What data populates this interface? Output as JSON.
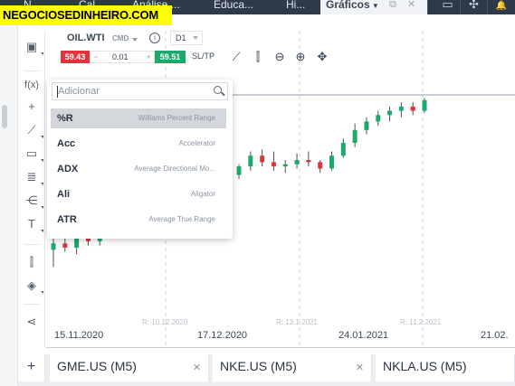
{
  "brand": "NEGOCIOSEDINHEIRO.COM",
  "top_tabs": [
    {
      "label": "N"
    },
    {
      "label": "Cal"
    },
    {
      "label": "Análise ..."
    },
    {
      "label": "Educa..."
    },
    {
      "label": "Hi..."
    },
    {
      "label": "Gráficos",
      "active": true
    }
  ],
  "top_icons": {
    "popout": "external-link-icon",
    "close": "close-icon"
  },
  "top_right": [
    {
      "name": "layout-icon",
      "glyph": "▭"
    },
    {
      "name": "settings-icon",
      "glyph": "✣"
    },
    {
      "name": "bell-icon",
      "glyph": "🔔"
    }
  ],
  "chart_header": {
    "symbol": "OIL.WTI",
    "type_label": "CMD",
    "info_glyph": "i",
    "timeframe": "D1",
    "sell_price": "59.43",
    "quantity": "0.01",
    "minus": "−",
    "plus": "+",
    "buy_price": "59.51",
    "sltp_label": "SL/TP"
  },
  "indicator_search": {
    "placeholder": "Adicionar",
    "items": [
      {
        "abbr": "%R",
        "name": "Williams Percent Range"
      },
      {
        "abbr": "Acc",
        "name": "Accelerator"
      },
      {
        "abbr": "ADX",
        "name": "Average Directional Mo..."
      },
      {
        "abbr": "Ali",
        "name": "Aligator"
      },
      {
        "abbr": "ATR",
        "name": "Average True Range"
      }
    ]
  },
  "rollover_labels": [
    "R: 10.12.2020",
    "R: 13.1.2021",
    "R: 11.2.2021"
  ],
  "x_axis_labels": [
    "15.11.2020",
    "17.12.2020",
    "24.01.2021",
    "21.02."
  ],
  "bottom_tabs": [
    {
      "label": "GME.US (M5)"
    },
    {
      "label": "NKE.US (M5)"
    },
    {
      "label": "NKLA.US (M5)"
    }
  ],
  "colors": {
    "up": "#1ea86c",
    "down": "#e0343d",
    "brand_bg": "#ffff00",
    "topbar": "#2e3a4a"
  },
  "chart_data": {
    "type": "candlestick",
    "series": [
      {
        "o": 1,
        "h": 1.6,
        "l": 0.2,
        "c": 1.3
      },
      {
        "o": 1.3,
        "h": 1.7,
        "l": 0.9,
        "c": 1.1
      },
      {
        "o": 1.1,
        "h": 1.8,
        "l": 0.8,
        "c": 1.6
      },
      {
        "o": 1.6,
        "h": 1.9,
        "l": 1.2,
        "c": 1.4
      },
      {
        "o": 1.4,
        "h": 2.3,
        "l": 1.2,
        "c": 2.1
      },
      {
        "o": 2.1,
        "h": 2.9,
        "l": 1.9,
        "c": 2.6
      },
      {
        "o": 2.6,
        "h": 3.0,
        "l": 2.2,
        "c": 2.4
      },
      {
        "o": 2.4,
        "h": 3.5,
        "l": 2.3,
        "c": 3.3
      },
      {
        "o": 3.3,
        "h": 3.6,
        "l": 2.9,
        "c": 3.2
      },
      {
        "o": 3.2,
        "h": 3.8,
        "l": 3.0,
        "c": 3.6
      },
      {
        "o": 3.6,
        "h": 4.1,
        "l": 3.2,
        "c": 3.9
      },
      {
        "o": 3.9,
        "h": 4.3,
        "l": 3.6,
        "c": 3.7
      },
      {
        "o": 3.7,
        "h": 4.6,
        "l": 3.5,
        "c": 4.4
      },
      {
        "o": 4.4,
        "h": 4.9,
        "l": 4.1,
        "c": 4.6
      },
      {
        "o": 4.6,
        "h": 5.1,
        "l": 4.2,
        "c": 4.8
      },
      {
        "o": 4.8,
        "h": 5.2,
        "l": 4.4,
        "c": 4.5
      },
      {
        "o": 4.5,
        "h": 5.0,
        "l": 4.3,
        "c": 4.9
      },
      {
        "o": 4.9,
        "h": 5.6,
        "l": 4.7,
        "c": 5.4
      },
      {
        "o": 5.4,
        "h": 5.7,
        "l": 4.9,
        "c": 5.1
      },
      {
        "o": 5.1,
        "h": 5.6,
        "l": 4.7,
        "c": 4.9
      },
      {
        "o": 4.9,
        "h": 5.2,
        "l": 4.6,
        "c": 5.0
      },
      {
        "o": 5.0,
        "h": 5.5,
        "l": 4.8,
        "c": 5.2
      },
      {
        "o": 5.2,
        "h": 5.6,
        "l": 4.9,
        "c": 5.1
      },
      {
        "o": 5.1,
        "h": 5.2,
        "l": 4.6,
        "c": 4.8
      },
      {
        "o": 4.8,
        "h": 5.6,
        "l": 4.7,
        "c": 5.4
      },
      {
        "o": 5.4,
        "h": 6.2,
        "l": 5.3,
        "c": 6.0
      },
      {
        "o": 6.0,
        "h": 6.9,
        "l": 5.8,
        "c": 6.6
      },
      {
        "o": 6.6,
        "h": 7.2,
        "l": 6.4,
        "c": 7.0
      },
      {
        "o": 7.0,
        "h": 7.5,
        "l": 6.8,
        "c": 7.3
      },
      {
        "o": 7.3,
        "h": 7.7,
        "l": 7.0,
        "c": 7.5
      },
      {
        "o": 7.5,
        "h": 7.9,
        "l": 7.2,
        "c": 7.7
      },
      {
        "o": 7.7,
        "h": 7.9,
        "l": 7.3,
        "c": 7.5
      },
      {
        "o": 7.5,
        "h": 8.1,
        "l": 7.4,
        "c": 8.0
      }
    ]
  }
}
